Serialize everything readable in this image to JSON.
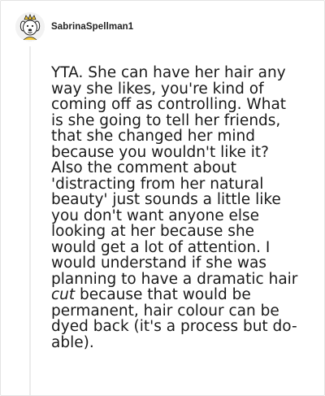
{
  "comment": {
    "author": "SabrinaSpellman1",
    "avatar_icon": "cartoon-dog-crown-icon",
    "text_before_emphasis": "YTA. She can have her hair any way she likes, you're kind of coming off as controlling. What is she going to tell her friends, that she changed her mind because you wouldn't like it? Also the comment about 'distracting from her natural beauty' just sounds a little like you don't want anyone else looking at her because she would get a lot of attention. I would understand if she was planning to have a dramatic hair ",
    "emphasis": "cut",
    "text_after_emphasis": " because that would be permanent, hair colour can be dyed back (it's a process but do-able)."
  },
  "colors": {
    "text": "#1a1a1a",
    "border": "#e4e4e4",
    "thread_line": "#ececec",
    "avatar_yellow": "#f3c83a"
  }
}
